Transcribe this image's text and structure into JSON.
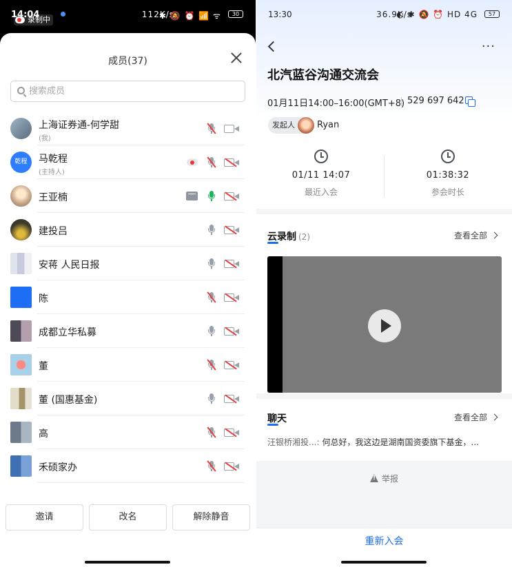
{
  "left": {
    "status": {
      "time": "14:04",
      "recording_label": "录制中",
      "speed": "112K/s",
      "icons": "✱ 🔕 ⏰ 📶 ᯤ",
      "battery": "30"
    },
    "sheet": {
      "title": "成员(37)",
      "search_placeholder": "搜索成员",
      "members": [
        {
          "name": "上海证券通-何学甜",
          "sub": "(我)",
          "avatar": "av-photo",
          "mic": "muted",
          "cam": "on"
        },
        {
          "name": "马乾程",
          "sub": "(主持人)",
          "avatar_text": "乾程",
          "avatar": "av-blue",
          "recording": true,
          "mic": "muted",
          "cam": "off"
        },
        {
          "name": "王亚楠",
          "sub": "",
          "avatar": "av-photo2",
          "sharing": true,
          "mic": "on",
          "cam": "off"
        },
        {
          "name": "建投吕",
          "sub": "",
          "avatar": "av-dark",
          "mic": "idle",
          "cam": "off"
        },
        {
          "name": "安蒋 人民日报",
          "sub": "",
          "avatar": "av-pix1",
          "mic": "idle",
          "cam": "off"
        },
        {
          "name": "陈",
          "sub": "",
          "avatar": "av-pix2",
          "mic": "muted",
          "cam": "off"
        },
        {
          "name": "成都立华私募",
          "sub": "",
          "avatar": "av-pix3",
          "mic": "idle",
          "cam": "off"
        },
        {
          "name": "董",
          "sub": "",
          "avatar": "av-pix4",
          "mic": "muted",
          "cam": "off"
        },
        {
          "name": "董 (国惠基金)",
          "sub": "",
          "avatar": "av-pix5",
          "mic": "idle",
          "cam": "off"
        },
        {
          "name": "高",
          "sub": "",
          "avatar": "av-pix6",
          "mic": "muted",
          "cam": "off"
        },
        {
          "name": "禾硕家办",
          "sub": "",
          "avatar": "av-pix7",
          "mic": "muted",
          "cam": "off"
        }
      ],
      "buttons": {
        "invite": "邀请",
        "rename": "改名",
        "unmute": "解除静音"
      }
    }
  },
  "right": {
    "status": {
      "time": "13:30",
      "speed": "36.9K/s",
      "icons": "◐ ✱ 🔕 ⏰ HD 4G",
      "battery": "57"
    },
    "meeting": {
      "title": "北汽蓝谷沟通交流会",
      "time": "01月11日14:00–16:00(GMT+8)",
      "meeting_id": "529 697 642",
      "host_tag": "发起人",
      "host_name": "Ryan"
    },
    "stats": [
      {
        "value": "01/11 14:07",
        "label": "最近入会"
      },
      {
        "value": "01:38:32",
        "label": "参会时长"
      }
    ],
    "recording": {
      "title": "云录制",
      "count": "(2)",
      "view_all": "查看全部"
    },
    "chat": {
      "title": "聊天",
      "view_all": "查看全部",
      "sender": "汪银桥湘投...:",
      "message": "何总好，我这边是湖南国资委旗下基金，..."
    },
    "report": "举报",
    "rejoin": "重新入会"
  },
  "colors": {
    "accent": "#1e6ff0",
    "muted_red": "#e34040",
    "mic_on": "#21b45a"
  }
}
